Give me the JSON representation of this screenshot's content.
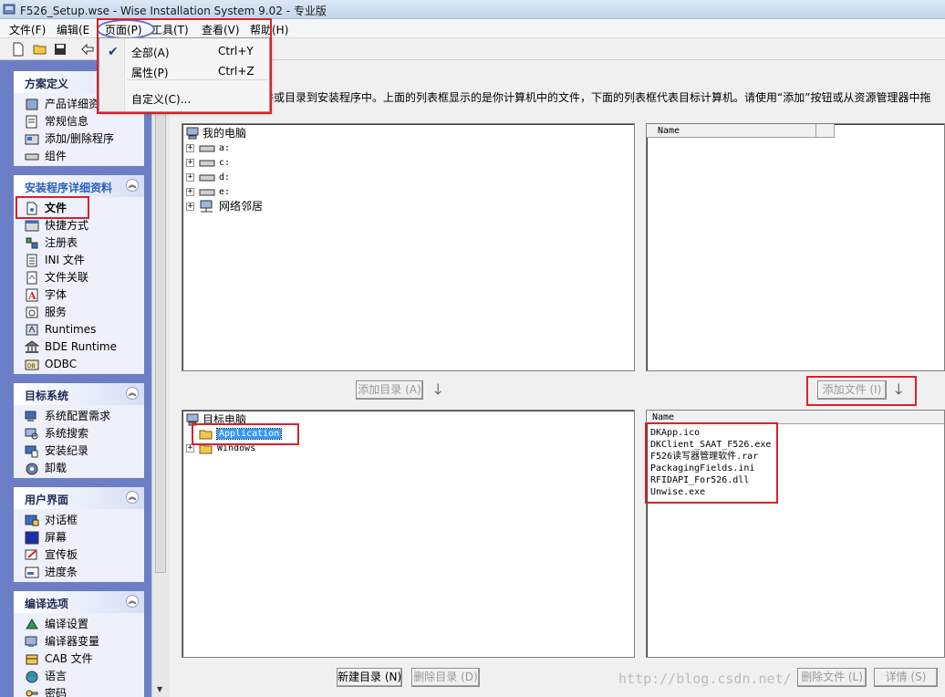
{
  "window": {
    "title": "F526_Setup.wse - Wise Installation System 9.02 - 专业版"
  },
  "menubar": {
    "file": "文件(F)",
    "edit": "编辑(E",
    "page": "页面(P)",
    "tools": "工具(T)",
    "view": "查看(V)",
    "help": "帮助(H)"
  },
  "page_menu": {
    "items": [
      {
        "label": "全部(A)",
        "shortcut": "Ctrl+Y",
        "checked": true
      },
      {
        "label": "属性(P)",
        "shortcut": "Ctrl+Z"
      },
      {
        "label": "自定义(C)..."
      }
    ]
  },
  "sidebar": {
    "groups": [
      {
        "title": "方案定义",
        "items": [
          "产品详细资",
          "常规信息",
          "添加/删除程序",
          "组件"
        ]
      },
      {
        "title": "安装程序详细资料",
        "items": [
          "文件",
          "快捷方式",
          "注册表",
          "INI 文件",
          "文件关联",
          "字体",
          "服务",
          "Runtimes",
          "BDE Runtime",
          "ODBC"
        ]
      },
      {
        "title": "目标系统",
        "items": [
          "系统配置需求",
          "系统搜索",
          "安装纪录",
          "卸载"
        ]
      },
      {
        "title": "用户界面",
        "items": [
          "对话框",
          "屏幕",
          "宣传板",
          "进度条"
        ]
      },
      {
        "title": "编译选项",
        "items": [
          "编译设置",
          "编译器变量",
          "CAB 文件",
          "语言",
          "密码"
        ]
      }
    ]
  },
  "main": {
    "instruction": "件或目录到安装程序中。上面的列表框显示的是你计算机中的文件，下面的列表框代表目标计算机。请使用“添加”按钮或从资源管理器中拖",
    "source_tree": {
      "root": "我的电脑",
      "items": [
        "a:",
        "c:",
        "d:",
        "e:",
        "网络邻居"
      ]
    },
    "source_list": {
      "column": "Name"
    },
    "add_dir_button": "添加目录 (A)",
    "add_file_button": "添加文件 (I)",
    "target_tree": {
      "root": "目标电脑",
      "items": [
        "Application",
        "Windows"
      ]
    },
    "target_list": {
      "column": "Name",
      "files": [
        "DKApp.ico",
        "DKClient_SAAT_F526.exe",
        "F526读写器管理软件.rar",
        "PackagingFields.ini",
        "RFIDAPI_For526.dll",
        "Unwise.exe"
      ]
    },
    "new_dir_button": "新建目录 (N)",
    "delete_dir_button": "删除目录 (D)",
    "delete_file_button": "删除文件 (L)",
    "details_button": "详情 (S)"
  },
  "watermark": "http://blog.csdn.net/",
  "colors": {
    "highlight": "#d8212c",
    "sidebar_bg": "#6c7fc6"
  }
}
